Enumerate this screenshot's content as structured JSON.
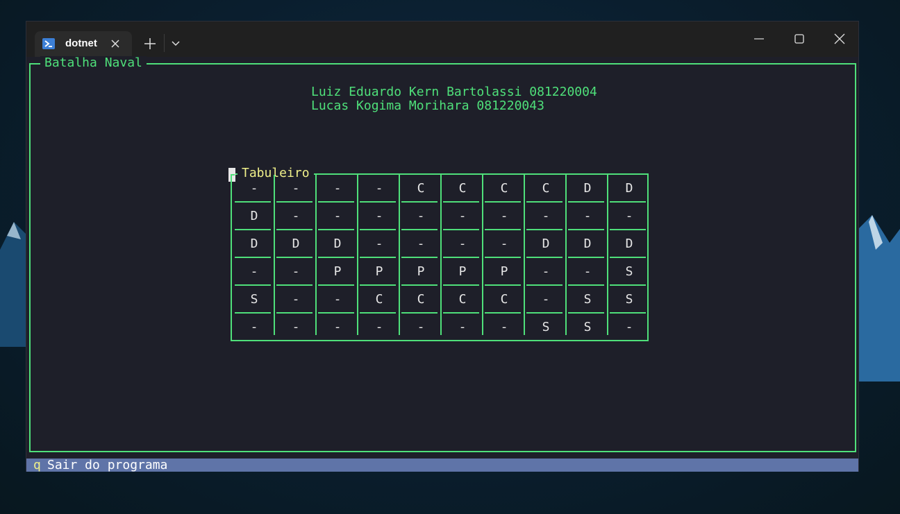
{
  "window": {
    "tab_title": "dotnet",
    "icon": "powershell-icon"
  },
  "terminal": {
    "frame_title": "Batalha Naval",
    "authors": [
      "Luiz Eduardo Kern Bartolassi 081220004",
      "Lucas Kogima Morihara 081220043"
    ],
    "board": {
      "title": "Tabuleiro",
      "rows": [
        [
          "-",
          "-",
          "-",
          "-",
          "C",
          "C",
          "C",
          "C",
          "D",
          "D"
        ],
        [
          "D",
          "-",
          "-",
          "-",
          "-",
          "-",
          "-",
          "-",
          "-",
          "-"
        ],
        [
          "D",
          "D",
          "D",
          "-",
          "-",
          "-",
          "-",
          "D",
          "D",
          "D"
        ],
        [
          "-",
          "-",
          "P",
          "P",
          "P",
          "P",
          "P",
          "-",
          "-",
          "S"
        ],
        [
          "S",
          "-",
          "-",
          "C",
          "C",
          "C",
          "C",
          "-",
          "S",
          "S"
        ],
        [
          "-",
          "-",
          "-",
          "-",
          "-",
          "-",
          "-",
          "S",
          "S",
          "-"
        ]
      ]
    }
  },
  "statusbar": {
    "key": "q",
    "label": "Sair do programa"
  },
  "colors": {
    "accent_green": "#4fe07a",
    "title_yellow": "#f0f08a",
    "status_bg": "#5f74a8",
    "terminal_bg": "#1e1f29"
  }
}
